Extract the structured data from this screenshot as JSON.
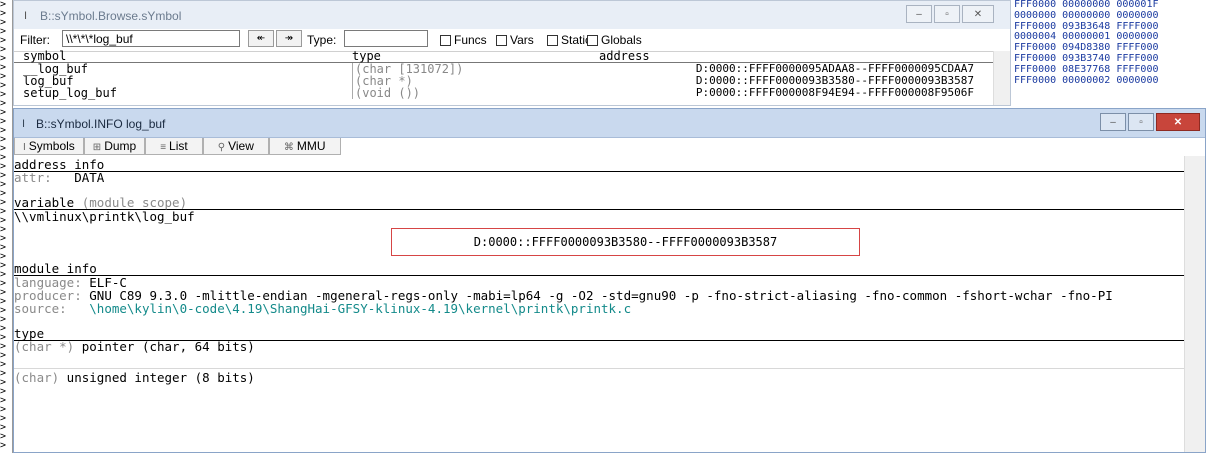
{
  "gutter": {
    "glyphs": [
      ">",
      ">",
      ">",
      ">",
      ">",
      ">",
      ">",
      ">",
      ">",
      ">",
      ">",
      ">",
      ">",
      ">",
      ">",
      ">",
      ">",
      ">",
      ">",
      ">",
      ">",
      ">",
      ">",
      ">",
      ">",
      ">",
      ">",
      ">",
      ">",
      ">",
      ">",
      ">",
      ">",
      ">",
      ">",
      ">",
      ">",
      ">",
      ">",
      ">",
      ">",
      ">",
      ">",
      ">",
      ">",
      ">",
      ">",
      ">",
      ">",
      ">"
    ]
  },
  "hex_panel": {
    "rows": [
      "FFF0000 00000000 000001F",
      "0000000 00000000 0000000",
      "FFF0000 093B3648 FFFF000",
      "0000004 00000001 0000000",
      "FFF0000 094D8380 FFFF000",
      "FFF0000 093B3740 FFFF000",
      "FFF0000 08E37768 FFFF000",
      "FFF0000 00000002 0000000"
    ]
  },
  "browse": {
    "title": "B::sYmbol.Browse.sYmbol",
    "filter_label": "Filter:",
    "filter_value": "\\\\*\\*\\*log_buf",
    "type_label": "Type:",
    "checkboxes": [
      "Funcs",
      "Vars",
      "Statics",
      "Globals"
    ],
    "columns": {
      "symbol": "symbol",
      "type": "type",
      "address": "address"
    },
    "rows": [
      {
        "symbol": "__log_buf",
        "type": "(char [131072])",
        "address": "D:0000::FFFF0000095ADAA8--FFFF0000095CDAA7"
      },
      {
        "symbol": "log_buf",
        "type": "(char *)",
        "address": "D:0000::FFFF0000093B3580--FFFF0000093B3587"
      },
      {
        "symbol": "setup_log_buf",
        "type": "(void ())",
        "address": "P:0000::FFFF000008F94E94--FFFF000008F9506F"
      }
    ]
  },
  "info": {
    "title": "B::sYmbol.INFO log_buf",
    "tabs": [
      {
        "label": "Symbols",
        "icon": "I"
      },
      {
        "label": "Dump",
        "icon": "⊞"
      },
      {
        "label": "List",
        "icon": "≡"
      },
      {
        "label": "View",
        "icon": "⚲"
      },
      {
        "label": "MMU",
        "icon": "⌘"
      }
    ],
    "address_info": {
      "heading": "address info",
      "attr_label": "attr:",
      "attr_value": "DATA"
    },
    "variable": {
      "heading": "variable",
      "scope": "(module scope)",
      "path": "\\\\vmlinux\\printk\\log_buf"
    },
    "highlighted_address": "D:0000::FFFF0000093B3580--FFFF0000093B3587",
    "module_info": {
      "heading": "module info",
      "language_label": "language:",
      "language_value": "ELF-C",
      "producer_label": "producer:",
      "producer_value": "GNU C89 9.3.0 -mlittle-endian -mgeneral-regs-only -mabi=lp64 -g -O2 -std=gnu90 -p -fno-strict-aliasing -fno-common -fshort-wchar -fno-PI",
      "source_label": "source:",
      "source_value": "\\home\\kylin\\0-code\\4.19\\ShangHai-GFSY-klinux-4.19\\kernel\\printk\\printk.c"
    },
    "type": {
      "heading": "type",
      "line1_prefix": "(char *)",
      "line1_rest": " pointer (char, 64 bits)",
      "line2_prefix": "(char)",
      "line2_rest": " unsigned integer (8 bits)"
    }
  },
  "icons": {
    "window": "info-i-icon",
    "minimize": "minimize-icon",
    "maximize": "maximize-icon",
    "close": "close-icon",
    "find_prev": "arrow-left-icon",
    "find_next": "arrow-right-icon"
  },
  "colors": {
    "highlight_border": "#d64545",
    "source_path": "#138a8a",
    "hex_text": "#1a3aa0",
    "close_button": "#c8453b"
  }
}
